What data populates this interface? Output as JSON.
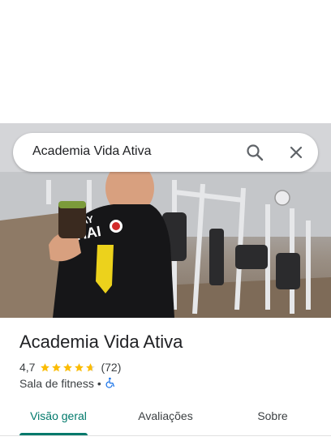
{
  "search": {
    "query": "Academia Vida Ativa",
    "search_icon": "search-icon",
    "close_icon": "close-icon"
  },
  "place": {
    "name": "Academia Vida Ativa",
    "rating": "4,7",
    "rating_value": 4.7,
    "review_count": "(72)",
    "category": "Sala de fitness",
    "separator": "•",
    "accessibility_icon": "wheelchair-accessible-icon"
  },
  "tabs": [
    {
      "label": "Visão geral",
      "active": true
    },
    {
      "label": "Avaliações",
      "active": false
    },
    {
      "label": "Sobre",
      "active": false
    }
  ],
  "colors": {
    "accent": "#00796b",
    "star": "#fbbc04",
    "accessibility": "#1a73e8"
  }
}
